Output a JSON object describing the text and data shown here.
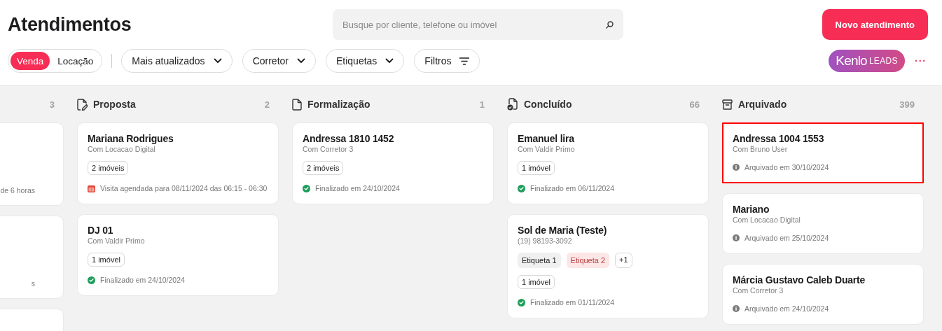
{
  "page_title": "Atendimentos",
  "search": {
    "placeholder": "Busque por cliente, telefone ou imóvel"
  },
  "new_button": "Novo atendimento",
  "mode_toggle": [
    {
      "label": "Venda",
      "selected": true
    },
    {
      "label": "Locação",
      "selected": false
    }
  ],
  "filters": [
    {
      "label": "Mais atualizados",
      "kind": "dropdown"
    },
    {
      "label": "Corretor",
      "kind": "dropdown"
    },
    {
      "label": "Etiquetas",
      "kind": "dropdown"
    },
    {
      "label": "Filtros",
      "kind": "filter"
    }
  ],
  "leads_badge": {
    "brand": "Kenlo",
    "suffix": "LEADS"
  },
  "more_menu": "···",
  "columns": [
    {
      "count": "3",
      "cards": [
        {
          "kind": "clipped",
          "status": {
            "text": "de 6 horas"
          }
        },
        {
          "kind": "clipped",
          "status": {
            "text": "s"
          }
        },
        {
          "kind": "clipped"
        }
      ]
    },
    {
      "kind": "proposal",
      "title": "Proposta",
      "count": "2",
      "cards": [
        {
          "name": "Mariana Rodrigues",
          "subtitle": "Com Locacao Digital",
          "chip": "2 imóveis",
          "status": {
            "kind": "scheduled",
            "text": "Visita agendada para 08/11/2024 das 06:15 - 06:30"
          },
          "highlighted": false
        },
        {
          "name": "DJ 01",
          "subtitle": "Com Valdir Primo",
          "chip": "1 imóvel",
          "status": {
            "kind": "done",
            "text": "Finalizado em 24/10/2024"
          },
          "highlighted": false
        }
      ]
    },
    {
      "kind": "formalization",
      "title": "Formalização",
      "count": "1",
      "cards": [
        {
          "name": "Andressa 1810 1452",
          "subtitle": "Com Corretor 3",
          "chip": "2 imóveis",
          "status": {
            "kind": "done",
            "text": "Finalizado em 24/10/2024"
          },
          "highlighted": false
        }
      ]
    },
    {
      "kind": "done",
      "title": "Concluído",
      "count": "66",
      "cards": [
        {
          "name": "Emanuel lira",
          "subtitle": "Com Valdir Primo",
          "chip": "1 imóvel",
          "status": {
            "kind": "done",
            "text": "Finalizado em 06/11/2024"
          },
          "highlighted": false
        },
        {
          "name": "Sol de Maria (Teste)",
          "subtitle": "(19) 98193-3092",
          "tags": [
            {
              "label": "Etiqueta 1",
              "color": "#f0f0f0"
            },
            {
              "label": "Etiqueta 2",
              "color": "#fde6e6"
            }
          ],
          "more_tags": "+1",
          "chip": "1 imóvel",
          "status": {
            "kind": "done",
            "text": "Finalizado em 01/11/2024"
          },
          "highlighted": false
        }
      ]
    },
    {
      "kind": "archive",
      "title": "Arquivado",
      "count": "399",
      "cards": [
        {
          "name": "Andressa 1004 1553",
          "subtitle": "Com Bruno User",
          "status": {
            "kind": "archived",
            "text": "Arquivado em 30/10/2024"
          },
          "highlighted": true
        },
        {
          "name": "Mariano",
          "subtitle": "Com Locacao Digital",
          "status": {
            "kind": "archived",
            "text": "Arquivado em 25/10/2024"
          },
          "highlighted": false
        },
        {
          "name": "Márcia Gustavo Caleb Duarte",
          "subtitle": "Com Corretor 3",
          "status": {
            "kind": "archived",
            "text": "Arquivado em 24/10/2024"
          },
          "highlighted": false
        }
      ]
    }
  ]
}
